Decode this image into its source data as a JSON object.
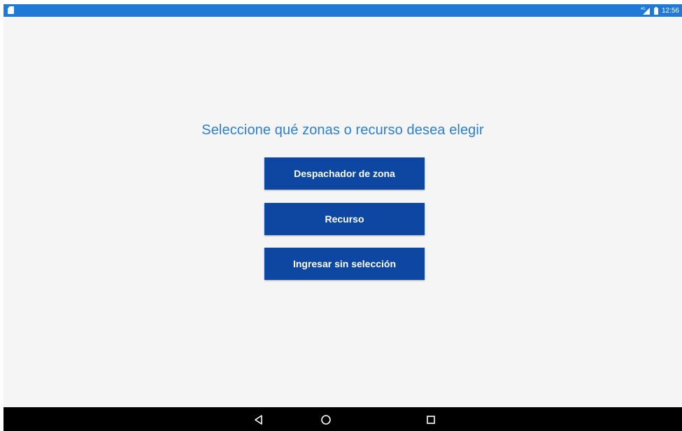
{
  "status_bar": {
    "time": "12:56",
    "network_label": "4G",
    "color": "#1e7ad6",
    "left_icon": "sd-card-icon",
    "icons": [
      "signal-icon",
      "battery-icon"
    ]
  },
  "main": {
    "title": "Seleccione qué zonas o recurso desea elegir",
    "buttons": [
      {
        "label": "Despachador de zona"
      },
      {
        "label": "Recurso"
      },
      {
        "label": "Ingresar sin selección"
      }
    ],
    "button_color": "#0d47a1",
    "title_color": "#2a7fd0"
  },
  "nav_bar": {
    "icons": [
      "back-icon",
      "home-icon",
      "recents-icon"
    ]
  }
}
